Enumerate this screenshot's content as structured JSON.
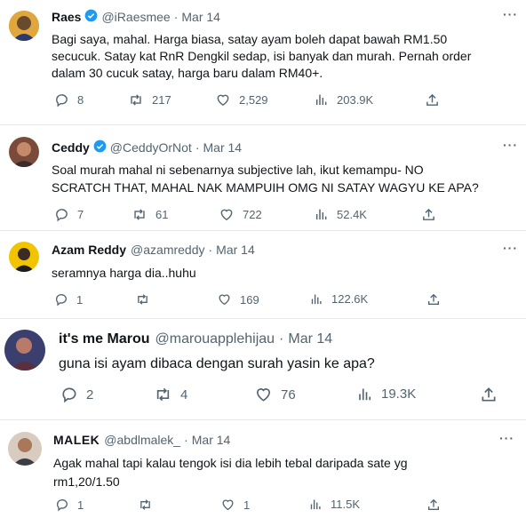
{
  "tweets": [
    {
      "name": "Raes",
      "handle": "@iRaesmee",
      "separator": "·",
      "date": "Mar 14",
      "verified": true,
      "text": "Bagi saya, mahal. Harga biasa, satay ayam boleh dapat bawah RM1.50\nsecucuk. Satay kat RnR Dengkil sedap, isi banyak dan murah. Pernah order\ndalam 30 cucuk satay, harga baru dalam RM40+.",
      "replies": "8",
      "retweets": "217",
      "likes": "2,529",
      "views": "203.9K"
    },
    {
      "name": "Ceddy",
      "handle": "@CeddyOrNot",
      "separator": "·",
      "date": "Mar 14",
      "verified": true,
      "text": "Soal murah mahal ni sebenarnya subjective lah, ikut kemampu- NO\nSCRATCH THAT, MAHAL NAK MAMPUIH OMG NI SATAY WAGYU KE APA?",
      "replies": "7",
      "retweets": "61",
      "likes": "722",
      "views": "52.4K"
    },
    {
      "name": "Azam Reddy",
      "handle": "@azamreddy",
      "separator": "·",
      "date": "Mar 14",
      "verified": false,
      "text": "seramnya harga dia..huhu",
      "replies": "1",
      "retweets": "",
      "likes": "169",
      "views": "122.6K"
    },
    {
      "name": "it's me Marou",
      "handle": "@marouapplehijau",
      "separator": "·",
      "date": "Mar 14",
      "verified": false,
      "text": "guna isi ayam dibaca dengan surah yasin ke apa?",
      "replies": "2",
      "retweets": "4",
      "likes": "76",
      "views": "19.3K"
    },
    {
      "name": "MALEK",
      "handle": "@abdlmalek_",
      "separator": "·",
      "date": "Mar 14",
      "verified": false,
      "text": "Agak mahal tapi kalau tengok isi dia lebih tebal daripada sate yg\nrm1,20/1.50",
      "replies": "1",
      "retweets": "",
      "likes": "1",
      "views": "11.5K"
    }
  ],
  "more_label": "···",
  "colors": {
    "verified": "#1d9bf0",
    "muted": "#536471",
    "text": "#0f1419"
  }
}
